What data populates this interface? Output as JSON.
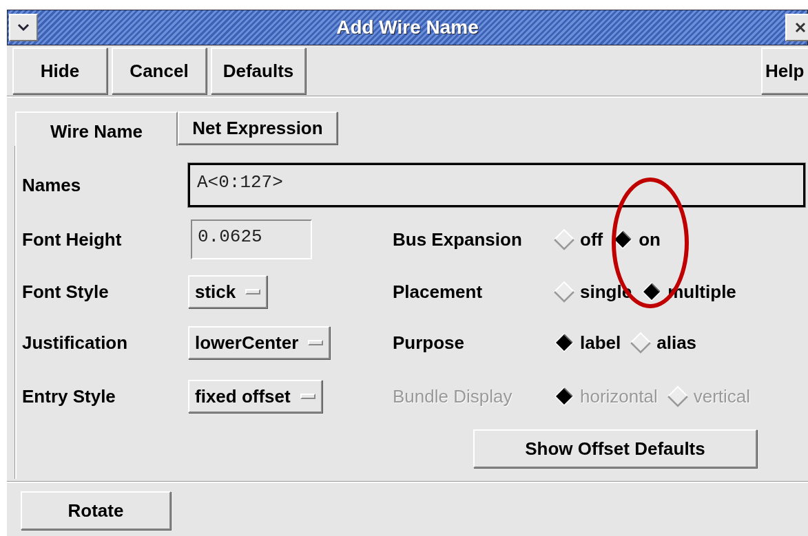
{
  "window": {
    "title": "Add Wire Name"
  },
  "toolbar": {
    "buttons": [
      "Hide",
      "Cancel",
      "Defaults"
    ],
    "help": "Help"
  },
  "tabs": [
    {
      "label": "Wire Name",
      "selected": true
    },
    {
      "label": "Net Expression",
      "selected": false
    }
  ],
  "names": {
    "label": "Names",
    "value": "A<0:127>"
  },
  "fields": [
    {
      "kind": "text",
      "label": "Font Height",
      "value": "0.0625"
    },
    {
      "kind": "menu",
      "label": "Font Style",
      "value": "stick"
    },
    {
      "kind": "menu",
      "label": "Justification",
      "value": "lowerCenter"
    },
    {
      "kind": "menu",
      "label": "Entry Style",
      "value": "fixed offset"
    }
  ],
  "options": [
    {
      "label": "Bus Expansion",
      "disabled": false,
      "choices": [
        {
          "label": "off",
          "selected": false
        },
        {
          "label": "on",
          "selected": true
        }
      ]
    },
    {
      "label": "Placement",
      "disabled": false,
      "choices": [
        {
          "label": "single",
          "selected": false
        },
        {
          "label": "multiple",
          "selected": true
        }
      ]
    },
    {
      "label": "Purpose",
      "disabled": false,
      "choices": [
        {
          "label": "label",
          "selected": true
        },
        {
          "label": "alias",
          "selected": false
        }
      ]
    },
    {
      "label": "Bundle Display",
      "disabled": true,
      "choices": [
        {
          "label": "horizontal",
          "selected": true
        },
        {
          "label": "vertical",
          "selected": false
        }
      ]
    }
  ],
  "offset_button": "Show Offset Defaults",
  "footer_button": "Rotate",
  "annotations": [
    {
      "kind": "ellipse"
    }
  ]
}
